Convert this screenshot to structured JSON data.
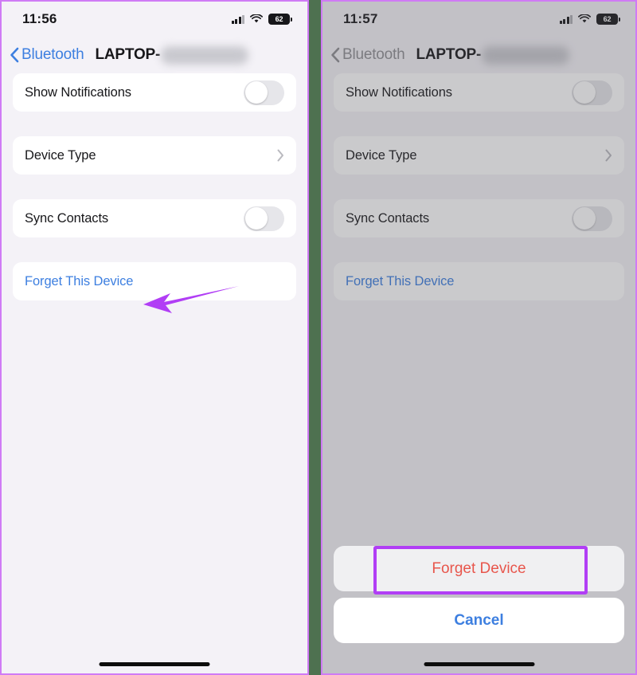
{
  "meta": {
    "accent_purple": "#b13ef5",
    "ios_blue": "#3d7fe0",
    "destructive_red": "#e8564c",
    "seam_green": "#4e7150",
    "panel_bg": "#f4f2f7",
    "row_bg": "#ffffff"
  },
  "panels": [
    {
      "id": "left",
      "status": {
        "time": "11:56",
        "cellular_icon": "cellular-signal-icon",
        "wifi_icon": "wifi-icon",
        "battery_icon": "battery-icon",
        "battery_percent": "62"
      },
      "nav": {
        "back_icon": "chevron-left-icon",
        "back_label": "Bluetooth",
        "title": "LAPTOP-",
        "title_redacted": true
      },
      "rows": [
        {
          "label": "Show Notifications",
          "control": "toggle",
          "toggle_on": false
        },
        {
          "label": "Device Type",
          "control": "disclosure",
          "disclosure_icon": "chevron-right-icon"
        },
        {
          "label": "Sync Contacts",
          "control": "toggle",
          "toggle_on": false
        },
        {
          "label": "Forget This Device",
          "control": "link"
        }
      ],
      "annotation": {
        "type": "arrow",
        "color": "#b13ef5",
        "points_to": "Forget This Device"
      },
      "home_indicator": true
    },
    {
      "id": "right",
      "dimmed": true,
      "status": {
        "time": "11:57",
        "cellular_icon": "cellular-signal-icon",
        "wifi_icon": "wifi-icon",
        "battery_icon": "battery-icon",
        "battery_percent": "62"
      },
      "nav": {
        "back_icon": "chevron-left-icon",
        "back_label": "Bluetooth",
        "title": "LAPTOP-",
        "title_redacted": true
      },
      "rows": [
        {
          "label": "Show Notifications",
          "control": "toggle",
          "toggle_on": false
        },
        {
          "label": "Device Type",
          "control": "disclosure",
          "disclosure_icon": "chevron-right-icon"
        },
        {
          "label": "Sync Contacts",
          "control": "toggle",
          "toggle_on": false
        },
        {
          "label": "Forget This Device",
          "control": "link"
        }
      ],
      "action_sheet": {
        "destructive_label": "Forget Device",
        "cancel_label": "Cancel",
        "highlighted": "Forget Device"
      },
      "home_indicator": true
    }
  ]
}
